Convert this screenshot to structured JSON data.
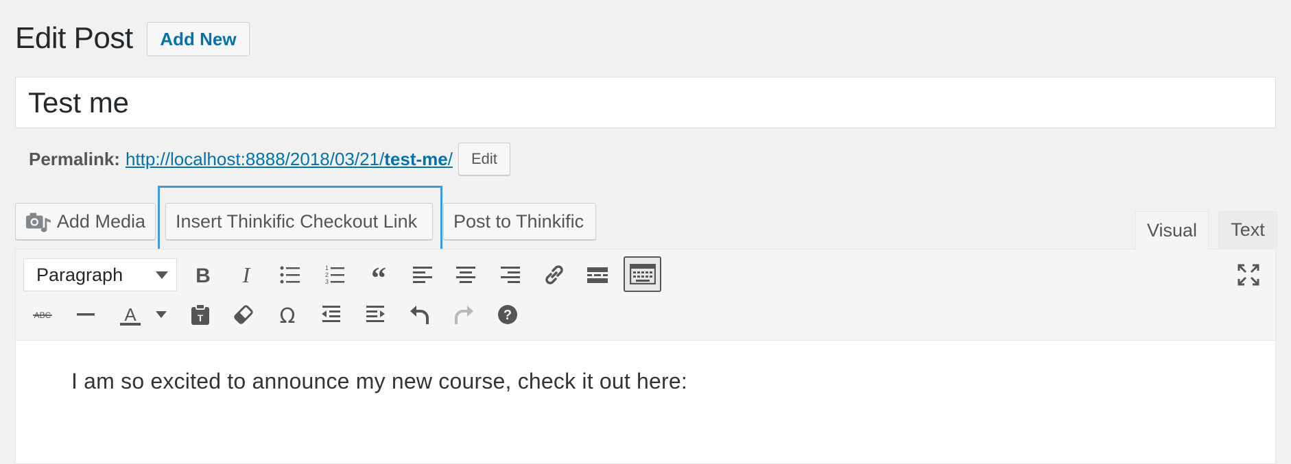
{
  "header": {
    "title": "Edit Post",
    "add_new_label": "Add New"
  },
  "post": {
    "title_value": "Test me"
  },
  "permalink": {
    "label": "Permalink:",
    "url_base": "http://localhost:8888/2018/03/21/",
    "url_slug": "test-me",
    "url_tail": "/",
    "edit_label": "Edit"
  },
  "media_buttons": {
    "add_media": "Add Media",
    "insert_checkout_link": "Insert Thinkific Checkout Link",
    "post_to_thinkific": "Post to Thinkific"
  },
  "editor_tabs": {
    "visual": "Visual",
    "text": "Text",
    "active": "visual"
  },
  "toolbar": {
    "format_select_value": "Paragraph",
    "row1_icons": [
      "bold-icon",
      "italic-icon",
      "bulleted-list-icon",
      "numbered-list-icon",
      "blockquote-icon",
      "align-left-icon",
      "align-center-icon",
      "align-right-icon",
      "link-icon",
      "read-more-icon",
      "toolbar-toggle-icon",
      "fullscreen-icon"
    ],
    "row2_icons": [
      "strikethrough-icon",
      "horizontal-line-icon",
      "text-color-icon",
      "paste-as-text-icon",
      "clear-formatting-icon",
      "special-character-icon",
      "outdent-icon",
      "indent-icon",
      "undo-icon",
      "redo-icon",
      "help-icon"
    ]
  },
  "editor": {
    "content": "I am so excited to announce my new course, check it out here:"
  },
  "colors": {
    "link": "#0073aa",
    "highlight": "#3c9ae1",
    "background": "#f1f1f1"
  }
}
